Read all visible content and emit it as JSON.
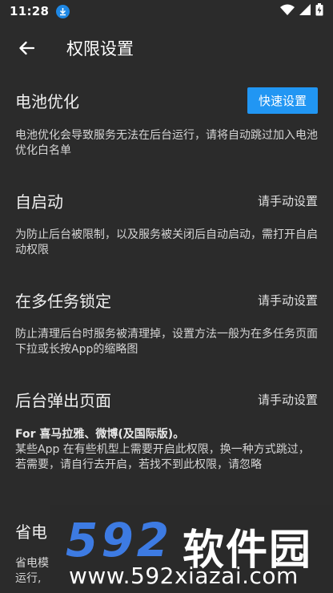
{
  "status": {
    "time": "11:28",
    "download_icon": "download-icon",
    "wifi_icon": "wifi-icon",
    "signal_icon": "signal-icon",
    "battery_icon": "battery-charging-icon"
  },
  "appbar": {
    "title": "权限设置"
  },
  "sections": {
    "battery": {
      "title": "电池优化",
      "button": "快速设置",
      "desc": "电池优化会导致服务无法在后台运行，请将自动跳过加入电池优化白名单"
    },
    "autostart": {
      "title": "自启动",
      "action": "请手动设置",
      "desc": "为防止后台被限制，以及服务被关闭后自动启动，需打开自启动权限"
    },
    "lock": {
      "title": "在多任务锁定",
      "action": "请手动设置",
      "desc": "防止清理后台时服务被清理掉，设置方法一般为在多任务页面下拉或长按App的缩略图"
    },
    "popup": {
      "title": "后台弹出页面",
      "action": "请手动设置",
      "desc_bold": "For 喜马拉雅、微博(及国际版)。",
      "desc": "某些App 在有些机型上需要开启此权限，换一种方式跳过，若需要，请自行去开启，若找不到此权限，请忽略"
    },
    "power": {
      "title": "省电",
      "desc_line1": "省电模",
      "desc_line2": "运行,"
    }
  },
  "watermark": {
    "number": "592",
    "name": "软件园",
    "url": "www.592xiazai.com"
  },
  "colors": {
    "background": "#2b2b2b",
    "accent": "#2196f3"
  }
}
